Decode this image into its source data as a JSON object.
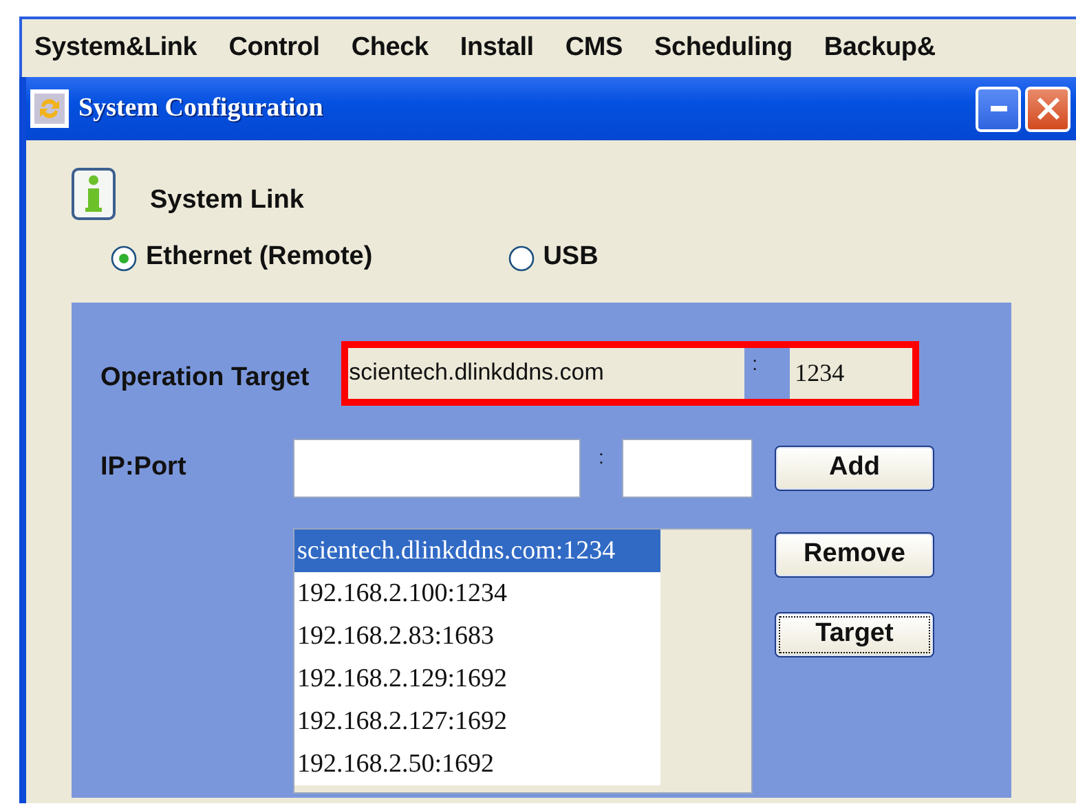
{
  "menu": [
    {
      "label": "System&Link"
    },
    {
      "label": "Control"
    },
    {
      "label": "Check"
    },
    {
      "label": "Install"
    },
    {
      "label": "CMS"
    },
    {
      "label": "Scheduling"
    },
    {
      "label": "Backup&"
    }
  ],
  "window": {
    "title": "System Configuration"
  },
  "section": {
    "title": "System Link"
  },
  "link_options": [
    {
      "label": "Ethernet (Remote)",
      "selected": true
    },
    {
      "label": "USB",
      "selected": false
    }
  ],
  "operation_target": {
    "label": "Operation Target",
    "host": "scientech.dlinkddns.com",
    "separator": ":",
    "port": "1234",
    "highlighted": true
  },
  "ip_port": {
    "label": "IP:Port",
    "separator": ":"
  },
  "buttons": [
    {
      "label": "Add",
      "focused": false
    },
    {
      "label": "Remove",
      "focused": false
    },
    {
      "label": "Target",
      "focused": true
    }
  ],
  "address_list": [
    {
      "label": "scientech.dlinkddns.com:1234",
      "selected": true
    },
    {
      "label": "192.168.2.100:1234",
      "selected": false
    },
    {
      "label": "192.168.2.83:1683",
      "selected": false
    },
    {
      "label": "192.168.2.129:1692",
      "selected": false
    },
    {
      "label": "192.168.2.127:1692",
      "selected": false
    },
    {
      "label": "192.168.2.50:1692",
      "selected": false
    }
  ]
}
